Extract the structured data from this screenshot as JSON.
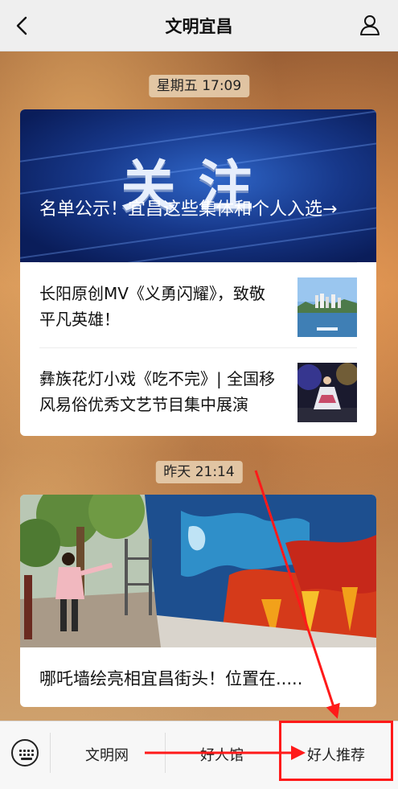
{
  "header": {
    "title": "文明宜昌"
  },
  "feed": [
    {
      "time": "星期五 17:09",
      "hero": {
        "overlay": "关注",
        "headline": "名单公示！宜昌这些集体和个人入选→"
      },
      "items": [
        {
          "text": "长阳原创MV《义勇闪耀》，致敬平凡英雄！"
        },
        {
          "text": "彝族花灯小戏《吃不完》| 全国移风易俗优秀文艺节目集中展演"
        }
      ]
    },
    {
      "time": "昨天 21:14",
      "caption": "哪吒墙绘亮相宜昌街头！位置在....."
    }
  ],
  "menu": {
    "items": [
      "文明网",
      "好人馆",
      "好人推荐"
    ],
    "highlighted": "好人推荐",
    "highlight_color": "#ff1a1a"
  }
}
